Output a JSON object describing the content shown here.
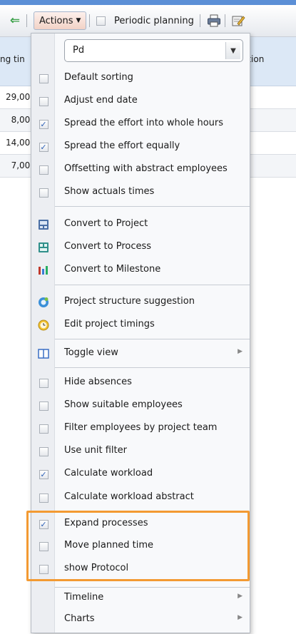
{
  "toolbar": {
    "actions_label": "Actions",
    "periodic_planning_label": "Periodic planning",
    "periodic_planning_checked": false
  },
  "grid": {
    "header_left": "ng tin",
    "header_right": "ation",
    "rows": [
      "29,00(",
      "8,00(",
      "14,00(",
      "7,00("
    ]
  },
  "menu": {
    "select_value": "Pd",
    "group1": [
      {
        "label": "Default sorting",
        "checked": false
      },
      {
        "label": "Adjust end date",
        "checked": false
      },
      {
        "label": "Spread the effort into whole hours",
        "checked": true
      },
      {
        "label": "Spread the effort equally",
        "checked": true
      },
      {
        "label": "Offsetting with abstract employees",
        "checked": false
      },
      {
        "label": "Show actuals times",
        "checked": false
      }
    ],
    "group2": [
      {
        "label": "Convert to Project",
        "icon": "project-icon"
      },
      {
        "label": "Convert to Process",
        "icon": "process-icon"
      },
      {
        "label": "Convert to Milestone",
        "icon": "milestone-icon"
      }
    ],
    "group3": [
      {
        "label": "Project structure suggestion",
        "icon": "structure-suggestion-icon"
      },
      {
        "label": "Edit project timings",
        "icon": "clock-icon"
      }
    ],
    "group4": [
      {
        "label": "Toggle view",
        "icon": "split-view-icon"
      }
    ],
    "group5": [
      {
        "label": "Hide absences",
        "checked": false
      },
      {
        "label": "Show suitable employees",
        "checked": false
      },
      {
        "label": "Filter employees by project team",
        "checked": false
      },
      {
        "label": "Use unit filter",
        "checked": false
      },
      {
        "label": "Calculate workload",
        "checked": true
      },
      {
        "label": "Calculate workload abstract",
        "checked": false
      },
      {
        "label": "Expand processes",
        "checked": true
      },
      {
        "label": "Move planned time",
        "checked": false
      },
      {
        "label": "show Protocol",
        "checked": false
      }
    ],
    "group6": [
      {
        "label": "Timeline"
      },
      {
        "label": "Charts"
      }
    ]
  },
  "colors": {
    "highlight": "#f39a32",
    "checkmark": "#2f62b7",
    "header_strip": "#5b8fd6"
  }
}
